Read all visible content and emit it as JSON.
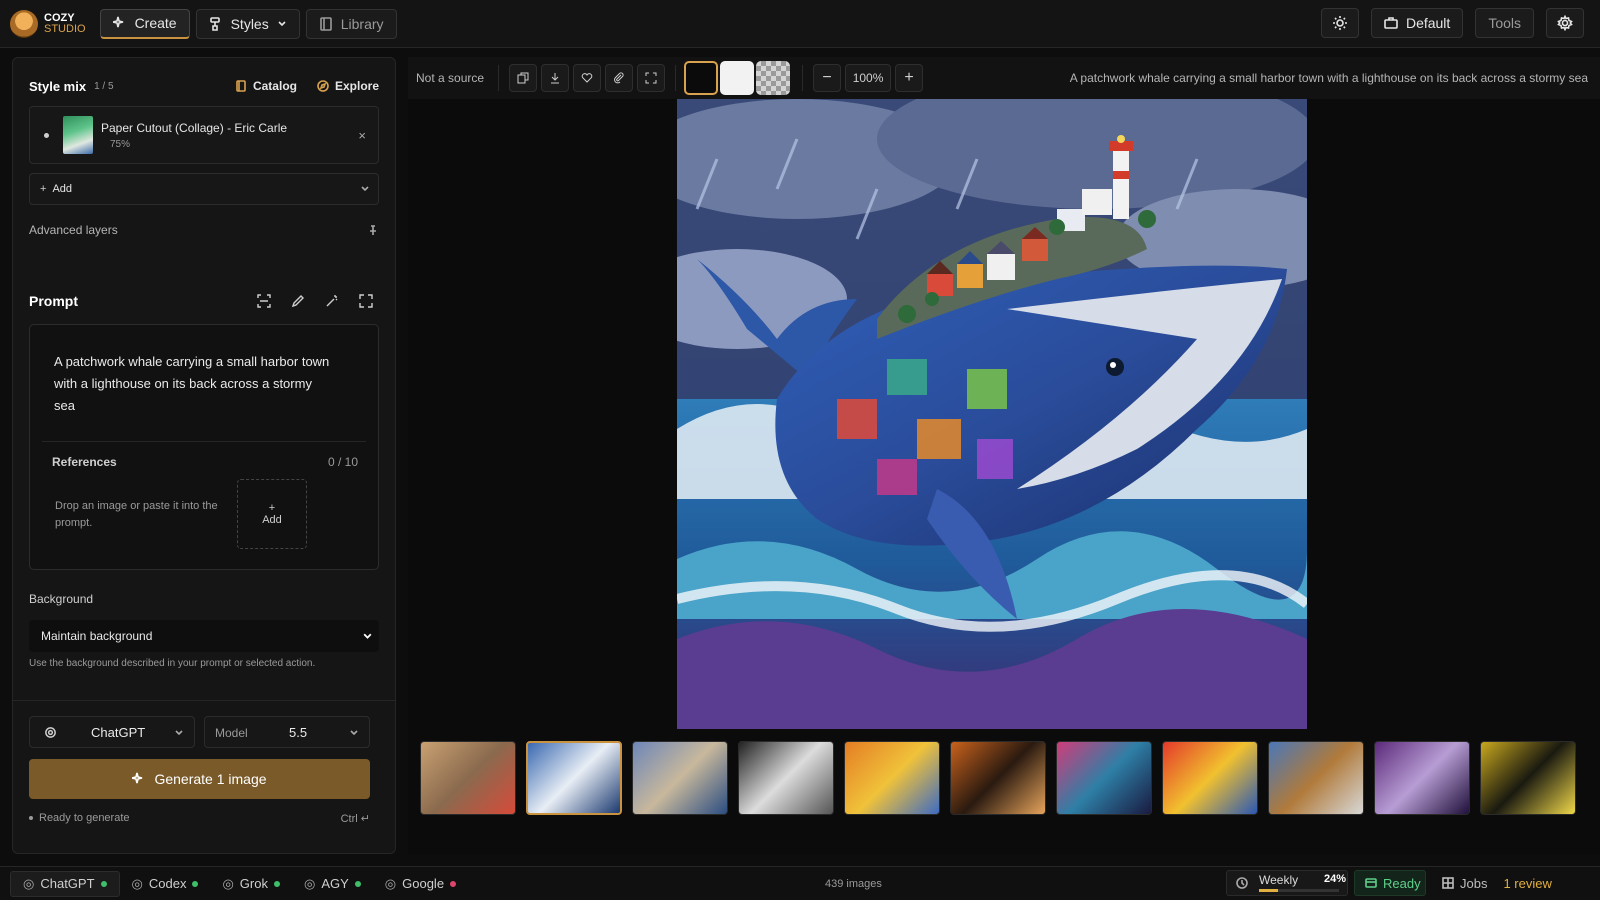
{
  "app": {
    "logo_line1": "COZY",
    "logo_line2": "STUDIO"
  },
  "nav": {
    "create": "Create",
    "styles": "Styles",
    "library": "Library"
  },
  "top_right": {
    "default_label": "Default",
    "tools_label": "Tools"
  },
  "style_mix": {
    "title": "Style mix",
    "count": "1 / 5",
    "catalog": "Catalog",
    "explore": "Explore",
    "item_name": "Paper Cutout (Collage) - Eric Carle",
    "item_weight": "75%",
    "add_label": "Add",
    "advanced_layers": "Advanced layers"
  },
  "prompt": {
    "title": "Prompt",
    "text": "A patchwork whale carrying a small harbor town with a lighthouse on its back across a stormy sea",
    "references_label": "References",
    "references_count": "0 / 10",
    "drop_hint": "Drop an image or paste it into the prompt.",
    "add_ref": "Add"
  },
  "background": {
    "label": "Background",
    "selected": "Maintain background",
    "hint": "Use the background described in your prompt or selected action."
  },
  "generate": {
    "provider": "ChatGPT",
    "model_label": "Model",
    "model_value": "5.5",
    "button": "Generate 1 image",
    "status": "Ready to generate",
    "shortcut": "Ctrl ↵"
  },
  "canvas": {
    "source_label": "Not a source",
    "zoom": "100%",
    "caption": "A patchwork whale carrying a small harbor town with a lighthouse on its back across a stormy sea"
  },
  "thumbnails": [
    {
      "name": "thumb-1",
      "colors": [
        "#c9a071",
        "#8a6a4e",
        "#d64b3a"
      ]
    },
    {
      "name": "thumb-2",
      "colors": [
        "#3a69b0",
        "#e8eef5",
        "#1c3a70"
      ],
      "selected": true
    },
    {
      "name": "thumb-3",
      "colors": [
        "#6d86b8",
        "#c8b89c",
        "#2b4d82"
      ]
    },
    {
      "name": "thumb-4",
      "colors": [
        "#222222",
        "#dcdcdc",
        "#555555"
      ]
    },
    {
      "name": "thumb-5",
      "colors": [
        "#e47d24",
        "#f0c23a",
        "#3e6bc2"
      ]
    },
    {
      "name": "thumb-6",
      "colors": [
        "#c9621c",
        "#2a1a10",
        "#e6a45b"
      ]
    },
    {
      "name": "thumb-7",
      "colors": [
        "#d03c7a",
        "#2e7fa6",
        "#1a1a40"
      ]
    },
    {
      "name": "thumb-8",
      "colors": [
        "#e43a2a",
        "#f1c12f",
        "#2b58b4"
      ]
    },
    {
      "name": "thumb-9",
      "colors": [
        "#4a78b8",
        "#b07a3a",
        "#d8d8d8"
      ]
    },
    {
      "name": "thumb-10",
      "colors": [
        "#5c2a7a",
        "#b79dd4",
        "#20103a"
      ]
    },
    {
      "name": "thumb-11",
      "colors": [
        "#c9a81e",
        "#1a1a10",
        "#f0d84a"
      ]
    }
  ],
  "status_bar": {
    "providers": [
      {
        "name": "ChatGPT",
        "dot": "#3fbf6a"
      },
      {
        "name": "Codex",
        "dot": "#3fbf6a"
      },
      {
        "name": "Grok",
        "dot": "#3fbf6a"
      },
      {
        "name": "AGY",
        "dot": "#3fbf6a"
      },
      {
        "name": "Google",
        "dot": "#e0446a"
      }
    ],
    "image_count": "439 images",
    "weekly_label": "Weekly",
    "weekly_pct": "24%",
    "weekly_fraction": 0.24,
    "ready": "Ready",
    "jobs": "Jobs",
    "review": "1 review"
  },
  "colors": {
    "accent": "#c9933f",
    "generate": "#7a5a28",
    "ok": "#3fbf6a"
  }
}
